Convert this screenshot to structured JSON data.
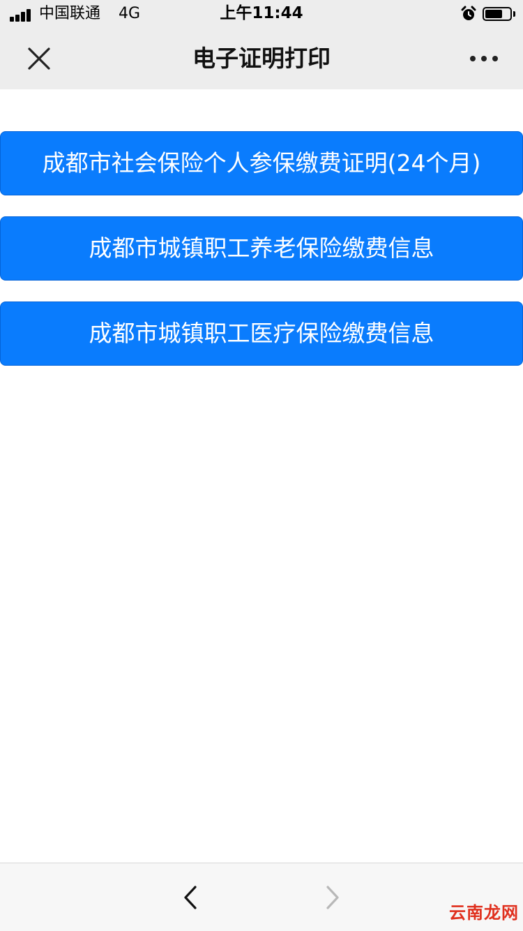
{
  "status_bar": {
    "carrier": "中国联通",
    "network": "4G",
    "time": "上午11:44"
  },
  "nav": {
    "title": "电子证明打印",
    "close_icon": "close-icon",
    "more_icon": "more-icon"
  },
  "buttons": [
    {
      "label": "成都市社会保险个人参保缴费证明(24个月)"
    },
    {
      "label": "成都市城镇职工养老保险缴费信息"
    },
    {
      "label": "成都市城镇职工医疗保险缴费信息"
    }
  ],
  "toolbar": {
    "back_icon": "chevron-left-icon",
    "forward_icon": "chevron-right-icon"
  },
  "watermark": {
    "text": "云南龙网"
  },
  "colors": {
    "button_bg": "#0a7cfd",
    "bar_bg": "#ededed",
    "toolbar_bg": "#f7f7f7",
    "watermark": "#e0301e"
  },
  "battery_level": 0.7
}
